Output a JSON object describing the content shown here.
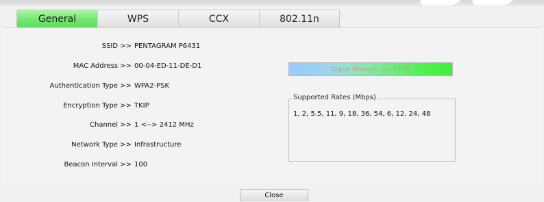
{
  "tabs": [
    {
      "label": "General",
      "active": true
    },
    {
      "label": "WPS",
      "active": false
    },
    {
      "label": "CCX",
      "active": false
    },
    {
      "label": "802.11n",
      "active": false
    }
  ],
  "info": {
    "ssid_label": "SSID >>",
    "ssid_value": "PENTAGRAM P6431",
    "mac_label": "MAC Address >>",
    "mac_value": "00-04-ED-11-DE-D1",
    "auth_label": "Authentication Type >>",
    "auth_value": "WPA2-PSK",
    "enc_label": "Encryption Type >>",
    "enc_value": "TKIP",
    "channel_label": "Channel >>",
    "channel_value": "1 <--> 2412 MHz",
    "network_label": "Network Type >>",
    "network_value": "Infrastructure",
    "beacon_label": "Beacon Interval >>",
    "beacon_value": "100"
  },
  "signal": {
    "text": "Signal Strength >> 100%",
    "percent": 100
  },
  "rates": {
    "legend": "Supported Rates (Mbps)",
    "list": "1, 2, 5.5, 11, 9, 18, 36, 54, 6, 12, 24, 48"
  },
  "buttons": {
    "close": "Close"
  },
  "colors": {
    "active_tab": "#6fe56d",
    "signal_text": "#e39a57"
  }
}
